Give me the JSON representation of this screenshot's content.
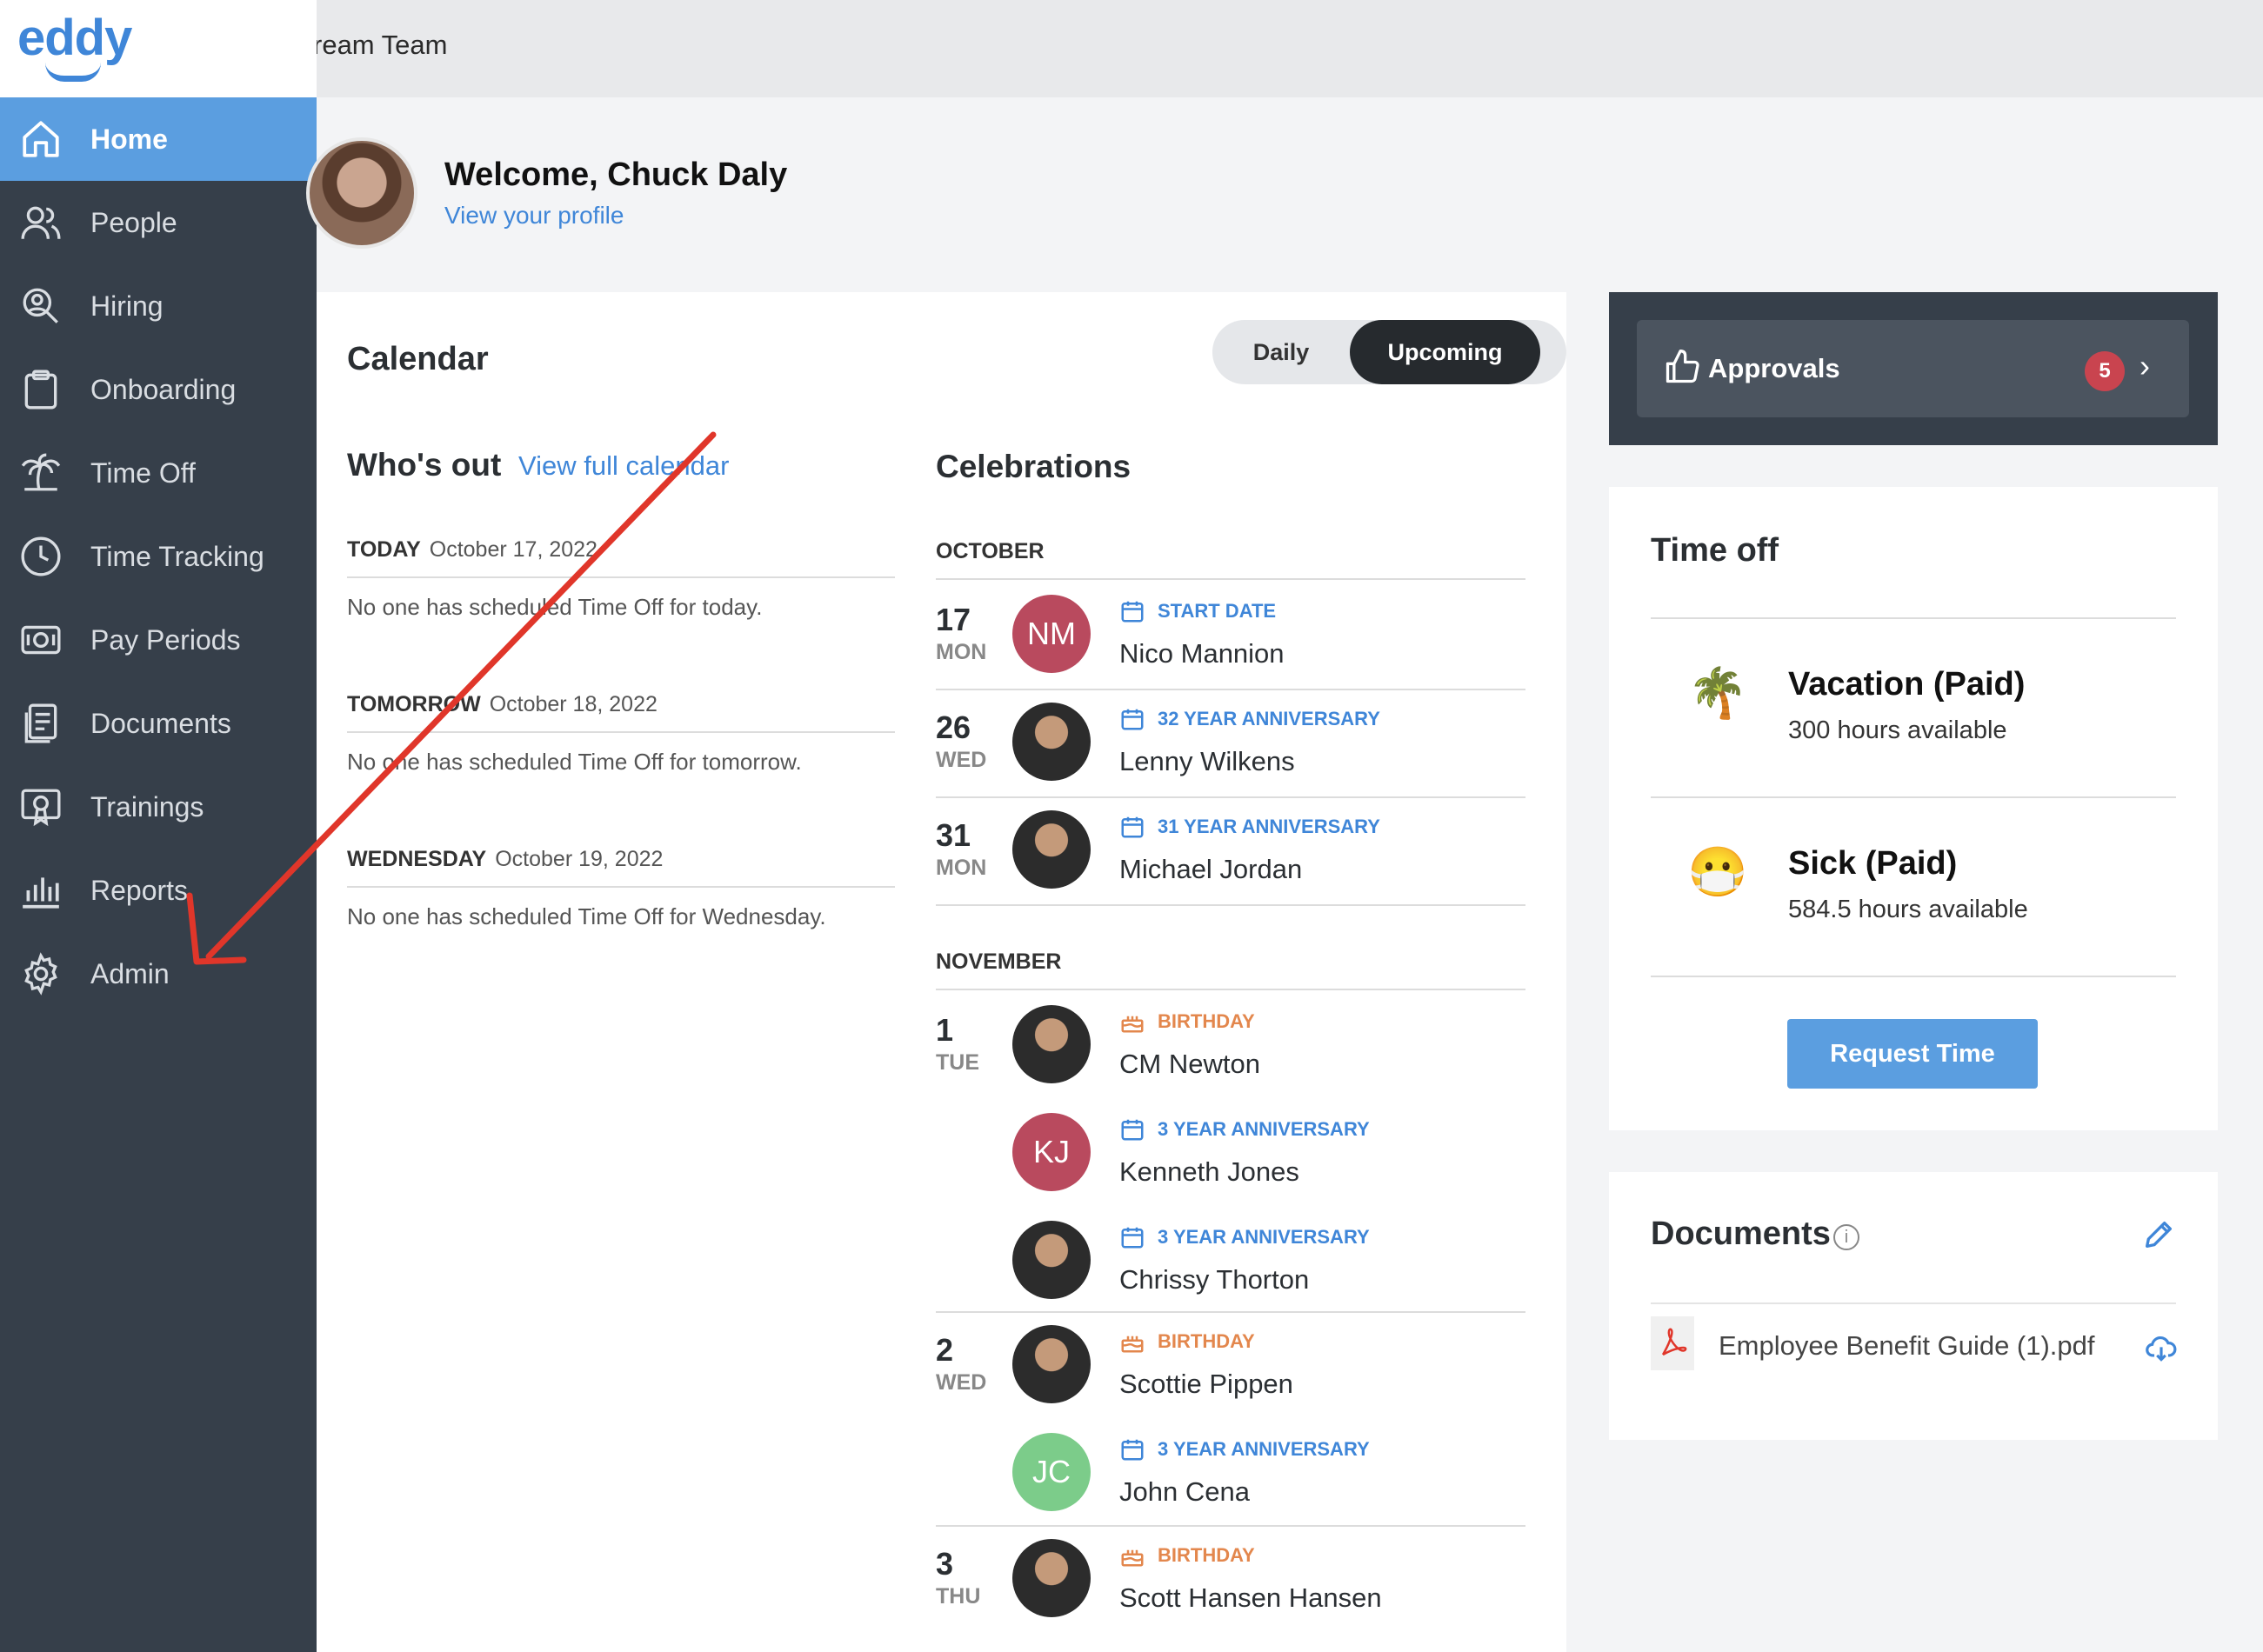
{
  "app": {
    "logo": "eddy",
    "team_name": "ream Team"
  },
  "sidebar": {
    "items": [
      {
        "label": "Home",
        "icon": "home-icon",
        "active": true
      },
      {
        "label": "People",
        "icon": "people-icon"
      },
      {
        "label": "Hiring",
        "icon": "hiring-icon"
      },
      {
        "label": "Onboarding",
        "icon": "clipboard-icon"
      },
      {
        "label": "Time Off",
        "icon": "palm-tree-icon"
      },
      {
        "label": "Time Tracking",
        "icon": "clock-icon"
      },
      {
        "label": "Pay Periods",
        "icon": "money-icon"
      },
      {
        "label": "Documents",
        "icon": "documents-icon"
      },
      {
        "label": "Trainings",
        "icon": "certificate-icon"
      },
      {
        "label": "Reports",
        "icon": "bar-chart-icon"
      },
      {
        "label": "Admin",
        "icon": "gear-icon"
      }
    ]
  },
  "welcome": {
    "greeting": "Welcome, Chuck Daly",
    "profile_link": "View your profile"
  },
  "calendar": {
    "title": "Calendar",
    "toggle": {
      "daily": "Daily",
      "upcoming": "Upcoming",
      "selected": "Upcoming"
    },
    "whos_out": {
      "title": "Who's out",
      "link": "View full calendar",
      "days": [
        {
          "label": "TODAY",
          "date": "October 17, 2022",
          "note": "No one has scheduled Time Off for today."
        },
        {
          "label": "TOMORROW",
          "date": "October 18, 2022",
          "note": "No one has scheduled Time Off for tomorrow."
        },
        {
          "label": "WEDNESDAY",
          "date": "October 19, 2022",
          "note": "No one has scheduled Time Off for Wednesday."
        }
      ]
    },
    "celebrations": {
      "title": "Celebrations",
      "months": [
        "OCTOBER",
        "NOVEMBER"
      ],
      "events": [
        {
          "day": "17",
          "dow": "MON",
          "type": "START DATE",
          "name": "Nico Mannion",
          "initials": "NM",
          "color": "#b94a5e"
        },
        {
          "day": "26",
          "dow": "WED",
          "type": "32 YEAR ANNIVERSARY",
          "name": "Lenny Wilkens"
        },
        {
          "day": "31",
          "dow": "MON",
          "type": "31 YEAR ANNIVERSARY",
          "name": "Michael Jordan"
        },
        {
          "day": "1",
          "dow": "TUE",
          "type": "BIRTHDAY",
          "name": "CM Newton"
        },
        {
          "day": "",
          "dow": "",
          "type": "3 YEAR ANNIVERSARY",
          "name": "Kenneth Jones",
          "initials": "KJ",
          "color": "#b94a5e"
        },
        {
          "day": "",
          "dow": "",
          "type": "3 YEAR ANNIVERSARY",
          "name": "Chrissy Thorton"
        },
        {
          "day": "2",
          "dow": "WED",
          "type": "BIRTHDAY",
          "name": "Scottie Pippen"
        },
        {
          "day": "",
          "dow": "",
          "type": "3 YEAR ANNIVERSARY",
          "name": "John Cena",
          "initials": "JC",
          "color": "#7ccc8a"
        },
        {
          "day": "3",
          "dow": "THU",
          "type": "BIRTHDAY",
          "name": "Scott Hansen Hansen"
        }
      ]
    }
  },
  "approvals": {
    "label": "Approvals",
    "count": "5"
  },
  "time_off": {
    "title": "Time off",
    "items": [
      {
        "name": "Vacation (Paid)",
        "hours": "300 hours available",
        "icon": "🌴"
      },
      {
        "name": "Sick (Paid)",
        "hours": "584.5 hours available",
        "icon": "😷"
      }
    ],
    "button": "Request Time"
  },
  "documents": {
    "title": "Documents",
    "info": "i",
    "files": [
      {
        "name": "Employee Benefit Guide (1).pdf"
      }
    ]
  },
  "colors": {
    "accent": "#3f86d8",
    "sidebar": "#363f4a",
    "active_nav": "#5b9ee0",
    "annotation_arrow": "#e0362a"
  }
}
